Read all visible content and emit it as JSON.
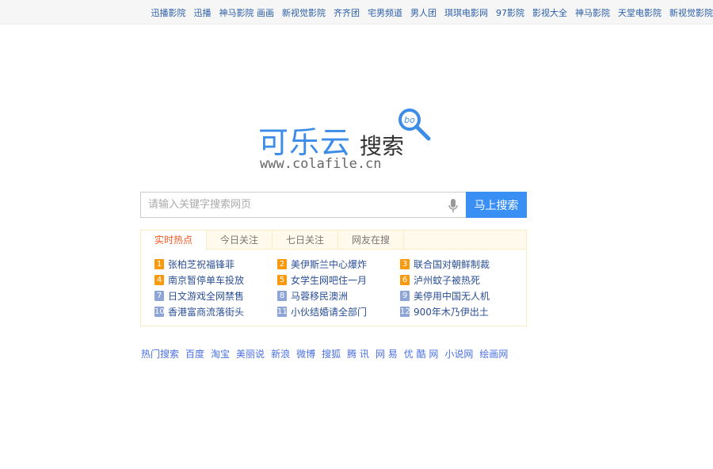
{
  "top_links": [
    "迅播影院",
    "迅播",
    "神马影院 画画",
    "新视觉影院",
    "齐齐团",
    "宅男频道",
    "男人团",
    "琪琪电影网",
    "97影院",
    "影视大全",
    "神马影院",
    "天堂电影院",
    "新视觉影院"
  ],
  "logo": {
    "main": "可乐云",
    "sub": "搜索",
    "badge": "bo",
    "url": "www.colafile.cn"
  },
  "search": {
    "placeholder": "请输入关键字搜索网页",
    "value": "",
    "button": "马上搜索",
    "mic_icon": "microphone-icon"
  },
  "hot": {
    "tabs": [
      "实时热点",
      "今日关注",
      "七日关注",
      "网友在搜"
    ],
    "items": [
      {
        "n": "1",
        "t": "张柏芝祝福锋菲"
      },
      {
        "n": "2",
        "t": "美伊斯兰中心爆炸"
      },
      {
        "n": "3",
        "t": "联合国对朝鲜制裁"
      },
      {
        "n": "4",
        "t": "南京暂停单车投放"
      },
      {
        "n": "5",
        "t": "女学生网吧住一月"
      },
      {
        "n": "6",
        "t": "泸州蚊子被热死"
      },
      {
        "n": "7",
        "t": "日文游戏全网禁售"
      },
      {
        "n": "8",
        "t": "马蓉移民澳洲"
      },
      {
        "n": "9",
        "t": "美停用中国无人机"
      },
      {
        "n": "10",
        "t": "香港富商流落街头"
      },
      {
        "n": "11",
        "t": "小伙结婚请全部门"
      },
      {
        "n": "12",
        "t": "900年木乃伊出土"
      }
    ]
  },
  "footer": {
    "label": "热门搜索",
    "links": [
      "百度",
      "淘宝",
      "美丽说",
      "新浪",
      "微博",
      "搜狐",
      "腾 讯",
      "网 易",
      "优 酷 网",
      "小说网",
      "绘画网"
    ]
  },
  "colors": {
    "accent": "#3a8ff5",
    "hot_orange": "#f99a0e",
    "rank_blue": "#8ea5d7",
    "active_tab": "#f65a22"
  }
}
